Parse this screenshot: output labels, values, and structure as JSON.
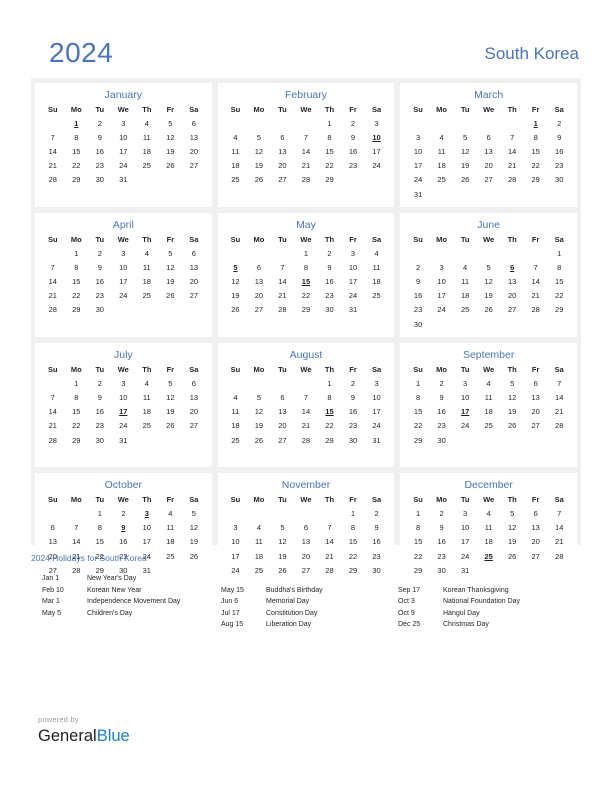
{
  "header": {
    "year": "2024",
    "country": "South Korea"
  },
  "colors": {
    "accent_blue": "#4a74bd",
    "holiday_red": "#e8112d",
    "band_gray": "#f0f0f0",
    "logo_blue": "#1c7fd4",
    "text": "#231f20"
  },
  "calendar": {
    "weekday_headers": [
      "Su",
      "Mo",
      "Tu",
      "We",
      "Th",
      "Fr",
      "Sa"
    ],
    "months": [
      {
        "name": "January",
        "lead_blanks": 1,
        "days_in_month": 31,
        "holidays": [
          1
        ]
      },
      {
        "name": "February",
        "lead_blanks": 4,
        "days_in_month": 29,
        "holidays": [
          10
        ]
      },
      {
        "name": "March",
        "lead_blanks": 5,
        "days_in_month": 31,
        "holidays": [
          1
        ]
      },
      {
        "name": "April",
        "lead_blanks": 1,
        "days_in_month": 30,
        "holidays": []
      },
      {
        "name": "May",
        "lead_blanks": 3,
        "days_in_month": 31,
        "holidays": [
          5,
          15
        ]
      },
      {
        "name": "June",
        "lead_blanks": 6,
        "days_in_month": 30,
        "holidays": [
          6
        ]
      },
      {
        "name": "July",
        "lead_blanks": 1,
        "days_in_month": 31,
        "holidays": [
          17
        ]
      },
      {
        "name": "August",
        "lead_blanks": 4,
        "days_in_month": 31,
        "holidays": [
          15
        ]
      },
      {
        "name": "September",
        "lead_blanks": 0,
        "days_in_month": 30,
        "holidays": [
          17
        ]
      },
      {
        "name": "October",
        "lead_blanks": 2,
        "days_in_month": 31,
        "holidays": [
          3,
          9
        ]
      },
      {
        "name": "November",
        "lead_blanks": 5,
        "days_in_month": 30,
        "holidays": []
      },
      {
        "name": "December",
        "lead_blanks": 0,
        "days_in_month": 31,
        "holidays": [
          25
        ]
      }
    ]
  },
  "holidays_section": {
    "title": "2024 Holidays for South Korea",
    "columns": [
      [
        {
          "date": "Jan 1",
          "name": "New Year's Day"
        },
        {
          "date": "Feb 10",
          "name": "Korean New Year"
        },
        {
          "date": "Mar 1",
          "name": "Independence Movement Day"
        },
        {
          "date": "May 5",
          "name": "Children's Day"
        }
      ],
      [
        {
          "date": "May 15",
          "name": "Buddha's Birthday"
        },
        {
          "date": "Jun 6",
          "name": "Memorial Day"
        },
        {
          "date": "Jul 17",
          "name": "Constitution Day"
        },
        {
          "date": "Aug 15",
          "name": "Liberation Day"
        }
      ],
      [
        {
          "date": "Sep 17",
          "name": "Korean Thanksgiving"
        },
        {
          "date": "Oct 3",
          "name": "National Foundation Day"
        },
        {
          "date": "Oct 9",
          "name": "Hangul Day"
        },
        {
          "date": "Dec 25",
          "name": "Christmas Day"
        }
      ]
    ],
    "column_offsets": [
      0,
      1,
      1
    ]
  },
  "footer": {
    "powered_by": "powered by",
    "logo_part_1": "General",
    "logo_part_2": "Blue"
  }
}
